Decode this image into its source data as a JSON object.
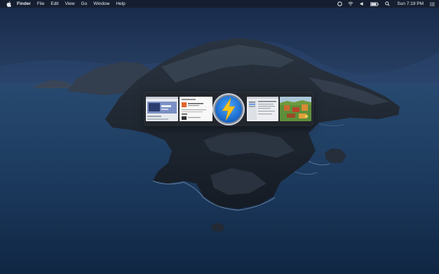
{
  "menubar": {
    "app_name": "Finder",
    "menus": [
      "File",
      "Edit",
      "View",
      "Go",
      "Window",
      "Help"
    ],
    "clock": "Sun 7:19 PM",
    "status_icons": [
      "circle-icon",
      "wifi-icon",
      "volume-icon",
      "battery-icon",
      "search-icon",
      "notification-center-icon"
    ]
  },
  "switcher": {
    "windows": [
      "browser-window-thumbnail",
      "web-page-thumbnail",
      "app-icon-lightning",
      "settings-window-thumbnail",
      "game-window-thumbnail"
    ]
  },
  "colors": {
    "menubar_bg": "#141a26",
    "icon_blue": "#1d7be0",
    "bolt_yellow": "#f7c520"
  }
}
